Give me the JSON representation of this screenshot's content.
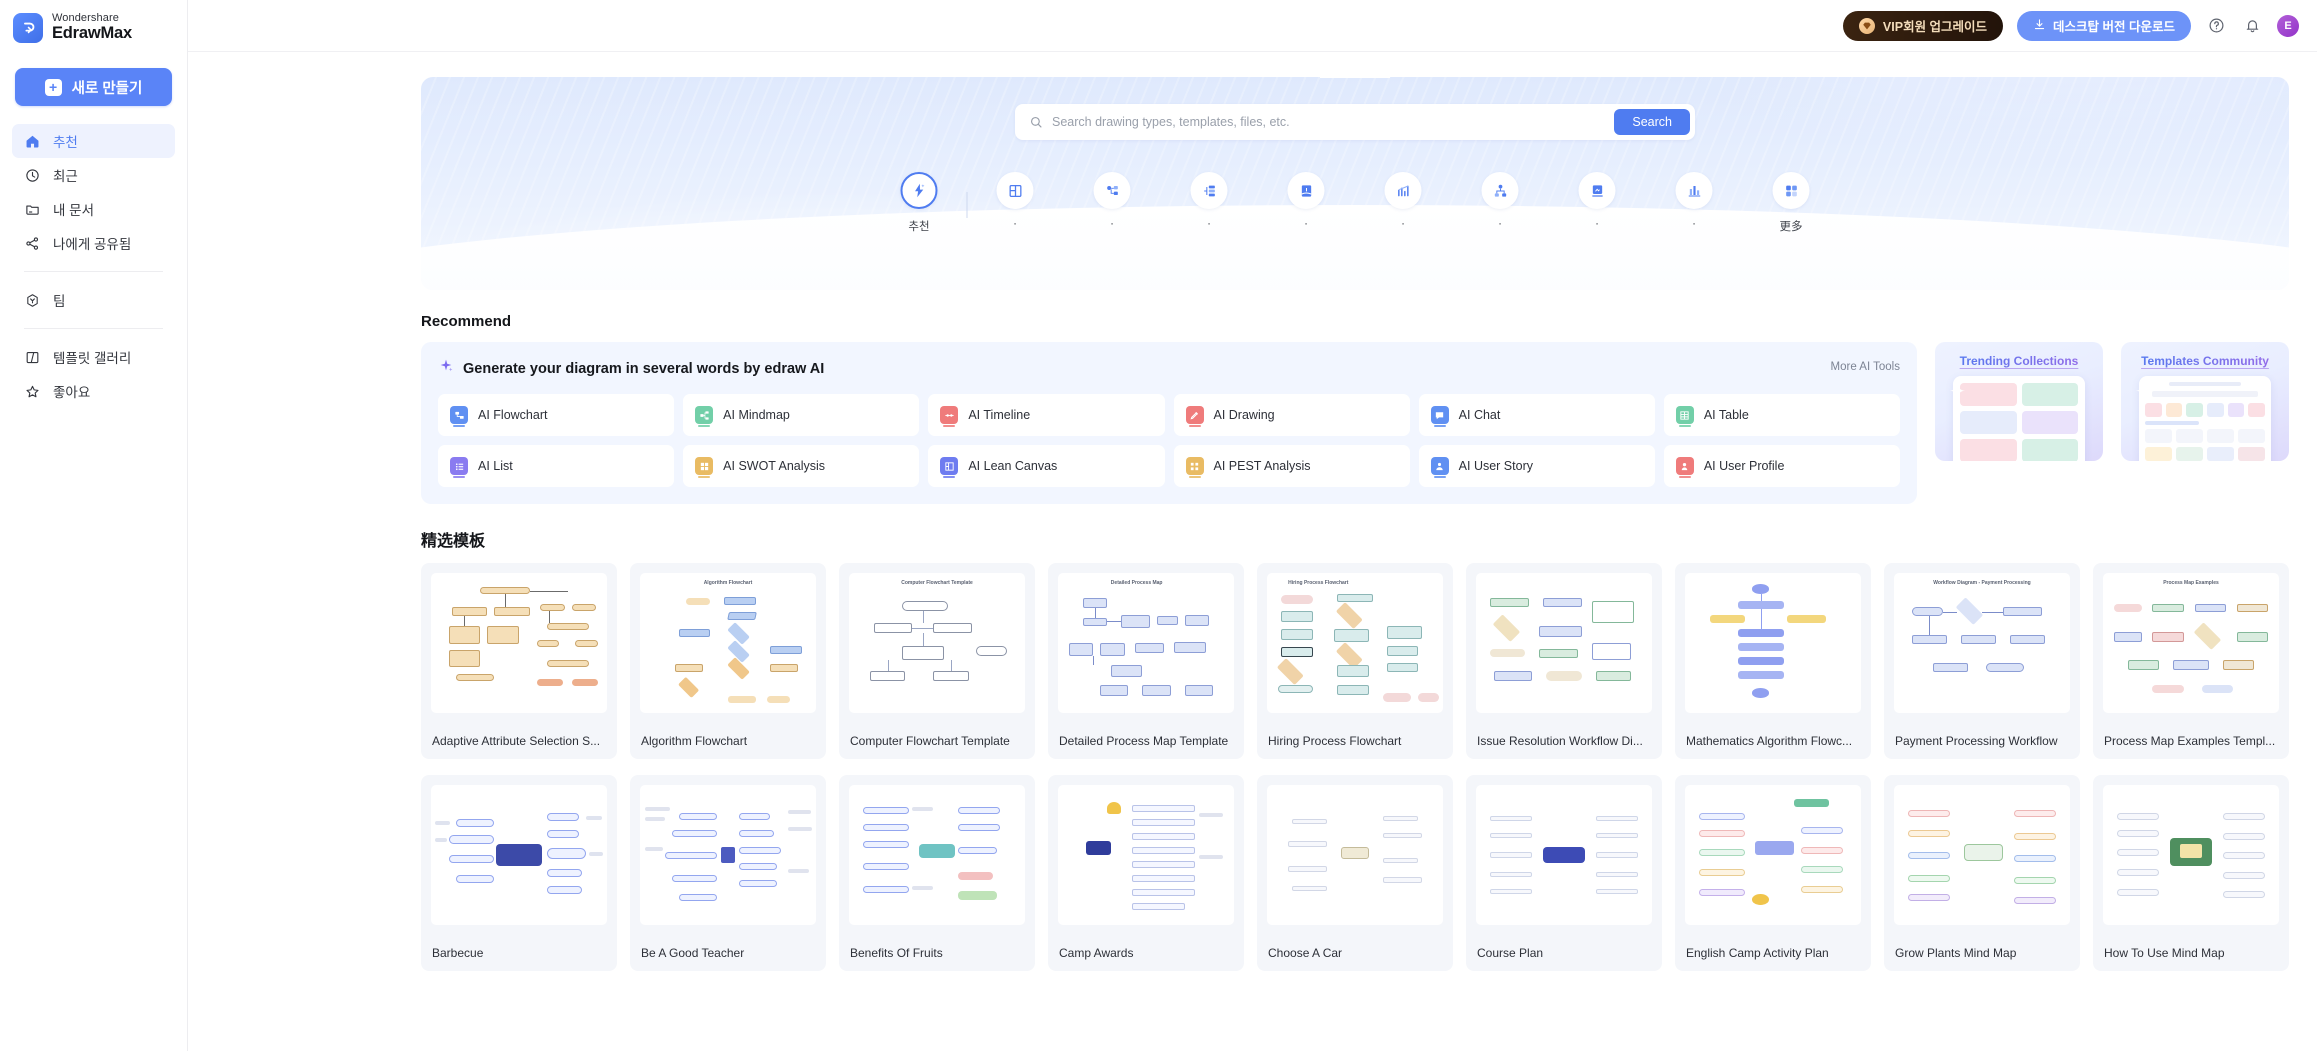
{
  "brand": {
    "top": "Wondershare",
    "bottom": "EdrawMax",
    "logo_icon": "edraw-logo-icon"
  },
  "sidebar": {
    "new_button": {
      "label": "새로 만들기",
      "icon": "plus-icon"
    },
    "items": [
      {
        "label": "추천",
        "icon": "home-icon",
        "active": true
      },
      {
        "label": "최근",
        "icon": "clock-icon",
        "active": false
      },
      {
        "label": "내 문서",
        "icon": "folder-icon",
        "active": false
      },
      {
        "label": "나에게 공유됨",
        "icon": "share-icon",
        "active": false
      },
      {
        "label": "팀",
        "icon": "team-hexagon-icon",
        "active": false
      },
      {
        "label": "템플릿 갤러리",
        "icon": "template-gallery-icon",
        "active": false
      },
      {
        "label": "좋아요",
        "icon": "star-icon",
        "active": false
      }
    ]
  },
  "topbar": {
    "vip_button": {
      "label": "VIP회원 업그레이드",
      "icon": "diamond-icon"
    },
    "download_button": {
      "label": "데스크탑 버전 다운로드",
      "icon": "download-icon"
    },
    "help_icon": "help-circle-icon",
    "notification_icon": "bell-icon",
    "avatar_initial": "E"
  },
  "hero": {
    "search": {
      "placeholder": "Search drawing types, templates, files, etc.",
      "value": "",
      "button_label": "Search",
      "icon": "search-icon"
    },
    "categories": [
      {
        "label": "추천",
        "icon": "recommend-sparkle-icon",
        "selected": true
      },
      {
        "label": "·",
        "icon": "grid-panel-icon",
        "selected": false
      },
      {
        "label": "·",
        "icon": "mindmap-icon",
        "selected": false
      },
      {
        "label": "·",
        "icon": "list-tree-icon",
        "selected": false
      },
      {
        "label": "·",
        "icon": "book-icon",
        "selected": false
      },
      {
        "label": "·",
        "icon": "chart-growth-icon",
        "selected": false
      },
      {
        "label": "·",
        "icon": "org-chart-icon",
        "selected": false
      },
      {
        "label": "·",
        "icon": "poster-icon",
        "selected": false
      },
      {
        "label": "·",
        "icon": "bar-chart-icon",
        "selected": false
      },
      {
        "label": "更多",
        "icon": "more-squares-icon",
        "selected": false
      }
    ]
  },
  "sections": {
    "recommend_title": "Recommend",
    "templates_title": "精选模板"
  },
  "ai_panel": {
    "title": "Generate your diagram in several words by edraw AI",
    "sparkle_icon": "ai-sparkle-icon",
    "more_link": "More AI Tools",
    "tools": [
      {
        "label": "AI Flowchart",
        "color": "#6090f2",
        "icon": "ai-flowchart-icon"
      },
      {
        "label": "AI Mindmap",
        "color": "#72cfa8",
        "icon": "ai-mindmap-icon"
      },
      {
        "label": "AI Timeline",
        "color": "#ef7b7b",
        "icon": "ai-timeline-icon"
      },
      {
        "label": "AI Drawing",
        "color": "#ef7b7b",
        "icon": "ai-drawing-icon"
      },
      {
        "label": "AI Chat",
        "color": "#6090f2",
        "icon": "ai-chat-icon"
      },
      {
        "label": "AI Table",
        "color": "#72cfa8",
        "icon": "ai-table-icon"
      },
      {
        "label": "AI List",
        "color": "#8a7bf0",
        "icon": "ai-list-icon"
      },
      {
        "label": "AI SWOT Analysis",
        "color": "#e9bb63",
        "icon": "ai-swot-icon"
      },
      {
        "label": "AI Lean Canvas",
        "color": "#6e7cf0",
        "icon": "ai-lean-canvas-icon"
      },
      {
        "label": "AI PEST Analysis",
        "color": "#e9bb63",
        "icon": "ai-pest-icon"
      },
      {
        "label": "AI User Story",
        "color": "#6090f2",
        "icon": "ai-user-story-icon"
      },
      {
        "label": "AI User Profile",
        "color": "#ef7b7b",
        "icon": "ai-user-profile-icon"
      }
    ]
  },
  "promos": [
    {
      "title": "Trending Collections",
      "kind": "tiles"
    },
    {
      "title": "Templates Community",
      "kind": "page"
    }
  ],
  "templates": {
    "row1": [
      {
        "name": "Adaptive Attribute Selection S...",
        "kind": "flow-orange"
      },
      {
        "name": "Algorithm Flowchart",
        "kind": "flow-blue",
        "caption": "Algorithm Flowchart"
      },
      {
        "name": "Computer Flowchart Template",
        "kind": "flow-plain",
        "caption": "Computer Flowchart Template"
      },
      {
        "name": "Detailed Process Map Template",
        "kind": "flow-indigo",
        "caption": "Detailed Process Map"
      },
      {
        "name": "Hiring Process Flowchart",
        "kind": "flow-mixed",
        "caption": "Hiring Process Flowchart"
      },
      {
        "name": "Issue Resolution Workflow Di...",
        "kind": "flow-green"
      },
      {
        "name": "Mathematics Algorithm Flowc...",
        "kind": "flow-violet"
      },
      {
        "name": "Payment Processing Workflow",
        "kind": "flow-steel",
        "caption": "Workflow Diagram - Payment Processing"
      },
      {
        "name": "Process Map Examples Templ...",
        "kind": "flow-wide",
        "caption": "Process Map Examples"
      }
    ],
    "row2": [
      {
        "name": "Barbecue",
        "kind": "mindmap-blue"
      },
      {
        "name": "Be A Good Teacher",
        "kind": "mindmap-fan"
      },
      {
        "name": "Benefits Of Fruits",
        "kind": "mindmap-fruit"
      },
      {
        "name": "Camp Awards",
        "kind": "mindmap-award"
      },
      {
        "name": "Choose A Car",
        "kind": "mindmap-sparse"
      },
      {
        "name": "Course Plan",
        "kind": "mindmap-center"
      },
      {
        "name": "English Camp Activity Plan",
        "kind": "mindmap-colorful"
      },
      {
        "name": "Grow Plants Mind Map",
        "kind": "mindmap-plants"
      },
      {
        "name": "How To Use Mind Map",
        "kind": "mindmap-howto"
      }
    ]
  },
  "colors": {
    "accent": "#4f7cf0",
    "sidebar_active_bg": "#eef2fe",
    "vip_bg": "#22130a",
    "panel_bg": "#f2f6ff",
    "card_bg": "#f4f6fa"
  }
}
